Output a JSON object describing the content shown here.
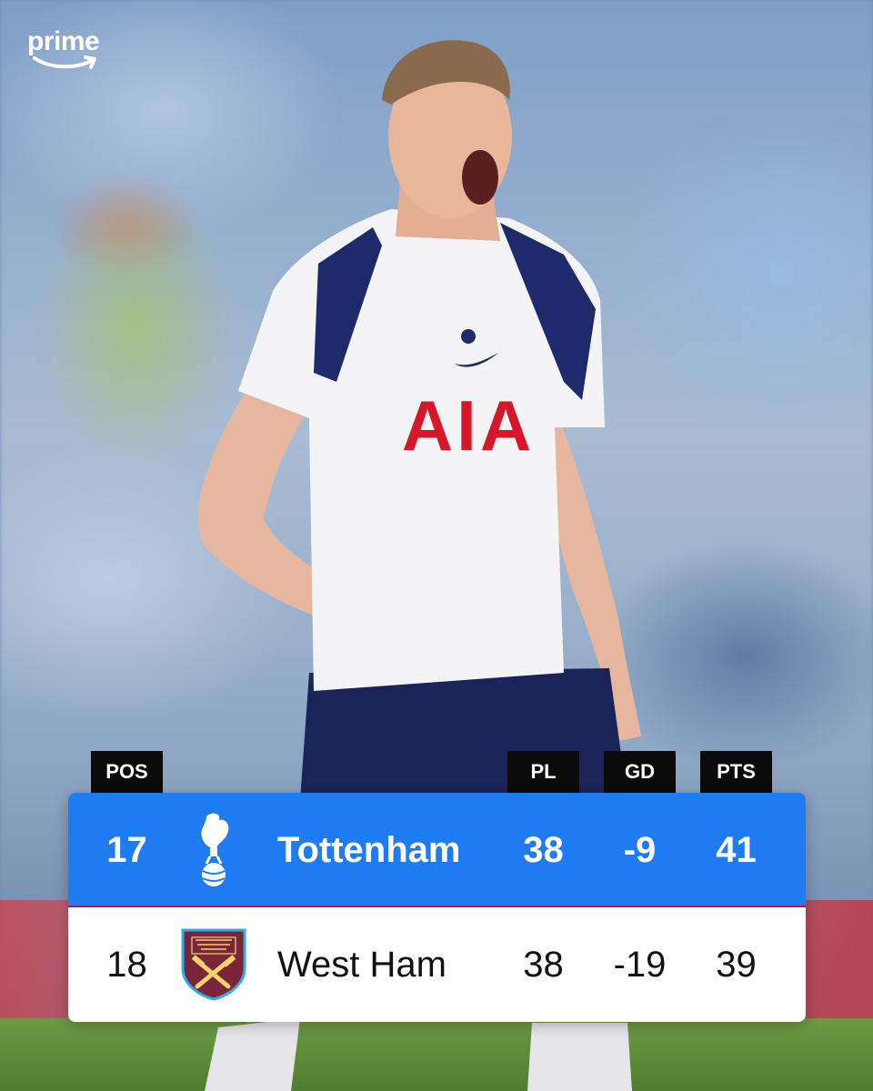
{
  "brand": {
    "logo_text": "prime",
    "logo_icon": "amazon-smile-icon"
  },
  "standings": {
    "headers": {
      "pos": "POS",
      "pl": "PL",
      "gd": "GD",
      "pts": "PTS"
    },
    "rows": [
      {
        "pos": "17",
        "crest": "tottenham-cockerel-crest",
        "team": "Tottenham",
        "pl": "38",
        "gd": "-9",
        "pts": "41",
        "highlighted": true
      },
      {
        "pos": "18",
        "crest": "west-ham-crest",
        "team": "West Ham",
        "pl": "38",
        "gd": "-19",
        "pts": "39",
        "highlighted": false
      }
    ]
  },
  "colors": {
    "highlight_row": "#1f7bf2",
    "header_bg": "#0b0b0b",
    "west_ham_claret": "#7a263a",
    "west_ham_blue": "#2dafe5"
  }
}
